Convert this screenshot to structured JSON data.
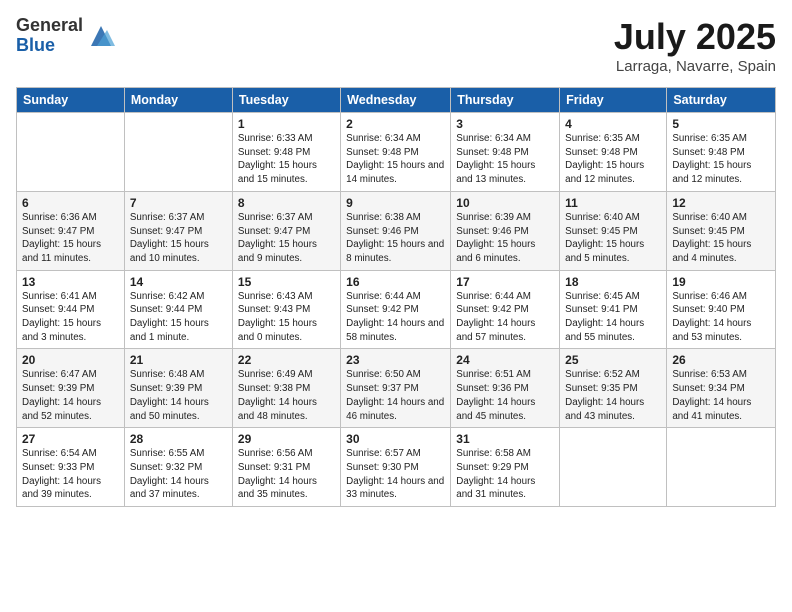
{
  "logo": {
    "general": "General",
    "blue": "Blue"
  },
  "title": "July 2025",
  "location": "Larraga, Navarre, Spain",
  "days_of_week": [
    "Sunday",
    "Monday",
    "Tuesday",
    "Wednesday",
    "Thursday",
    "Friday",
    "Saturday"
  ],
  "weeks": [
    [
      {
        "day": "",
        "info": ""
      },
      {
        "day": "",
        "info": ""
      },
      {
        "day": "1",
        "info": "Sunrise: 6:33 AM\nSunset: 9:48 PM\nDaylight: 15 hours\nand 15 minutes."
      },
      {
        "day": "2",
        "info": "Sunrise: 6:34 AM\nSunset: 9:48 PM\nDaylight: 15 hours\nand 14 minutes."
      },
      {
        "day": "3",
        "info": "Sunrise: 6:34 AM\nSunset: 9:48 PM\nDaylight: 15 hours\nand 13 minutes."
      },
      {
        "day": "4",
        "info": "Sunrise: 6:35 AM\nSunset: 9:48 PM\nDaylight: 15 hours\nand 12 minutes."
      },
      {
        "day": "5",
        "info": "Sunrise: 6:35 AM\nSunset: 9:48 PM\nDaylight: 15 hours\nand 12 minutes."
      }
    ],
    [
      {
        "day": "6",
        "info": "Sunrise: 6:36 AM\nSunset: 9:47 PM\nDaylight: 15 hours\nand 11 minutes."
      },
      {
        "day": "7",
        "info": "Sunrise: 6:37 AM\nSunset: 9:47 PM\nDaylight: 15 hours\nand 10 minutes."
      },
      {
        "day": "8",
        "info": "Sunrise: 6:37 AM\nSunset: 9:47 PM\nDaylight: 15 hours\nand 9 minutes."
      },
      {
        "day": "9",
        "info": "Sunrise: 6:38 AM\nSunset: 9:46 PM\nDaylight: 15 hours\nand 8 minutes."
      },
      {
        "day": "10",
        "info": "Sunrise: 6:39 AM\nSunset: 9:46 PM\nDaylight: 15 hours\nand 6 minutes."
      },
      {
        "day": "11",
        "info": "Sunrise: 6:40 AM\nSunset: 9:45 PM\nDaylight: 15 hours\nand 5 minutes."
      },
      {
        "day": "12",
        "info": "Sunrise: 6:40 AM\nSunset: 9:45 PM\nDaylight: 15 hours\nand 4 minutes."
      }
    ],
    [
      {
        "day": "13",
        "info": "Sunrise: 6:41 AM\nSunset: 9:44 PM\nDaylight: 15 hours\nand 3 minutes."
      },
      {
        "day": "14",
        "info": "Sunrise: 6:42 AM\nSunset: 9:44 PM\nDaylight: 15 hours\nand 1 minute."
      },
      {
        "day": "15",
        "info": "Sunrise: 6:43 AM\nSunset: 9:43 PM\nDaylight: 15 hours\nand 0 minutes."
      },
      {
        "day": "16",
        "info": "Sunrise: 6:44 AM\nSunset: 9:42 PM\nDaylight: 14 hours\nand 58 minutes."
      },
      {
        "day": "17",
        "info": "Sunrise: 6:44 AM\nSunset: 9:42 PM\nDaylight: 14 hours\nand 57 minutes."
      },
      {
        "day": "18",
        "info": "Sunrise: 6:45 AM\nSunset: 9:41 PM\nDaylight: 14 hours\nand 55 minutes."
      },
      {
        "day": "19",
        "info": "Sunrise: 6:46 AM\nSunset: 9:40 PM\nDaylight: 14 hours\nand 53 minutes."
      }
    ],
    [
      {
        "day": "20",
        "info": "Sunrise: 6:47 AM\nSunset: 9:39 PM\nDaylight: 14 hours\nand 52 minutes."
      },
      {
        "day": "21",
        "info": "Sunrise: 6:48 AM\nSunset: 9:39 PM\nDaylight: 14 hours\nand 50 minutes."
      },
      {
        "day": "22",
        "info": "Sunrise: 6:49 AM\nSunset: 9:38 PM\nDaylight: 14 hours\nand 48 minutes."
      },
      {
        "day": "23",
        "info": "Sunrise: 6:50 AM\nSunset: 9:37 PM\nDaylight: 14 hours\nand 46 minutes."
      },
      {
        "day": "24",
        "info": "Sunrise: 6:51 AM\nSunset: 9:36 PM\nDaylight: 14 hours\nand 45 minutes."
      },
      {
        "day": "25",
        "info": "Sunrise: 6:52 AM\nSunset: 9:35 PM\nDaylight: 14 hours\nand 43 minutes."
      },
      {
        "day": "26",
        "info": "Sunrise: 6:53 AM\nSunset: 9:34 PM\nDaylight: 14 hours\nand 41 minutes."
      }
    ],
    [
      {
        "day": "27",
        "info": "Sunrise: 6:54 AM\nSunset: 9:33 PM\nDaylight: 14 hours\nand 39 minutes."
      },
      {
        "day": "28",
        "info": "Sunrise: 6:55 AM\nSunset: 9:32 PM\nDaylight: 14 hours\nand 37 minutes."
      },
      {
        "day": "29",
        "info": "Sunrise: 6:56 AM\nSunset: 9:31 PM\nDaylight: 14 hours\nand 35 minutes."
      },
      {
        "day": "30",
        "info": "Sunrise: 6:57 AM\nSunset: 9:30 PM\nDaylight: 14 hours\nand 33 minutes."
      },
      {
        "day": "31",
        "info": "Sunrise: 6:58 AM\nSunset: 9:29 PM\nDaylight: 14 hours\nand 31 minutes."
      },
      {
        "day": "",
        "info": ""
      },
      {
        "day": "",
        "info": ""
      }
    ]
  ]
}
